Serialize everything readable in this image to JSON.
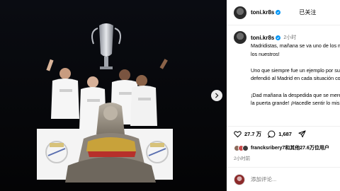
{
  "post": {
    "username": "toni.kr8s",
    "follow_state": "已关注",
    "caption_time": "2小时",
    "caption": "Madridistas, mañana se va uno de los más grandes. ¡Uno de los nuestros!\n\nUno que siempre fue un ejemplo por su actitud. Uno que defendió al Madrid en cada situación con todo lo que tenía.\n\n¡Dad mañana la despedida que se merece! ¡Dejadle salir por la puerta grande! ¡Hacedle sentir lo mismo…",
    "likes_count": "27.7 万",
    "comments_count": "1,687",
    "liked_by_user": "francksribery7",
    "liked_by_rest": "和其他27.6万位用户",
    "post_time": "2小时前",
    "comment_placeholder": "添加评论..."
  },
  "icons": {
    "next": "chevron-right-icon",
    "verified": "verified-badge-icon",
    "like": "heart-icon",
    "comment": "comment-bubble-icon",
    "share": "send-icon"
  },
  "colors": {
    "verified": "#0095f6",
    "panel_bg": "#ffffff",
    "media_bg": "#050506",
    "secondary_text": "#737373"
  }
}
